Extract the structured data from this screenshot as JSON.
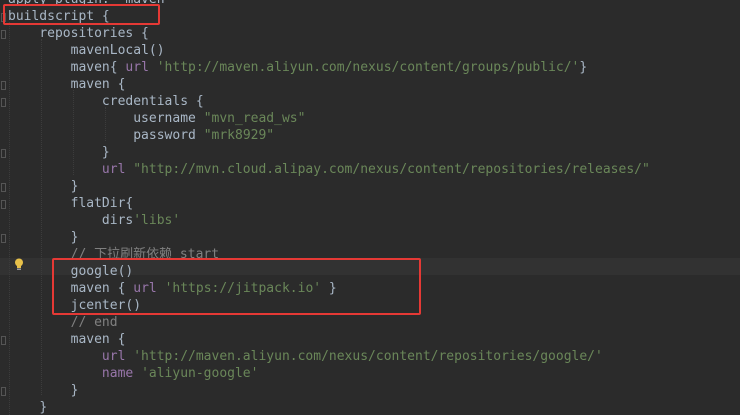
{
  "editor": {
    "lines": [
      {
        "indent": "",
        "parts": [
          {
            "t": "apply plugin: 'maven'",
            "c": "k"
          }
        ]
      },
      {
        "indent": "",
        "parts": [
          {
            "t": "buildscript {",
            "c": "k"
          }
        ]
      },
      {
        "indent": "    ",
        "parts": [
          {
            "t": "repositories {",
            "c": "k"
          }
        ]
      },
      {
        "indent": "        ",
        "parts": [
          {
            "t": "mavenLocal()",
            "c": "k"
          }
        ]
      },
      {
        "indent": "        ",
        "parts": [
          {
            "t": "maven{ ",
            "c": "k"
          },
          {
            "t": "url",
            "c": "p"
          },
          {
            "t": " ",
            "c": "k"
          },
          {
            "t": "'http://maven.aliyun.com/nexus/content/groups/public/'",
            "c": "s"
          },
          {
            "t": "}",
            "c": "k"
          }
        ]
      },
      {
        "indent": "        ",
        "parts": [
          {
            "t": "maven {",
            "c": "k"
          }
        ]
      },
      {
        "indent": "            ",
        "parts": [
          {
            "t": "credentials {",
            "c": "k"
          }
        ]
      },
      {
        "indent": "                ",
        "parts": [
          {
            "t": "username ",
            "c": "k"
          },
          {
            "t": "\"mvn_read_ws\"",
            "c": "s"
          }
        ]
      },
      {
        "indent": "                ",
        "parts": [
          {
            "t": "password ",
            "c": "k"
          },
          {
            "t": "\"mrk8929\"",
            "c": "s"
          }
        ]
      },
      {
        "indent": "            ",
        "parts": [
          {
            "t": "}",
            "c": "k"
          }
        ]
      },
      {
        "indent": "            ",
        "parts": [
          {
            "t": "url",
            "c": "p"
          },
          {
            "t": " ",
            "c": "k"
          },
          {
            "t": "\"http://mvn.cloud.alipay.com/nexus/content/repositories/releases/\"",
            "c": "s"
          }
        ]
      },
      {
        "indent": "        ",
        "parts": [
          {
            "t": "}",
            "c": "k"
          }
        ]
      },
      {
        "indent": "        ",
        "parts": [
          {
            "t": "flatDir{",
            "c": "k"
          }
        ]
      },
      {
        "indent": "            ",
        "parts": [
          {
            "t": "dirs",
            "c": "k"
          },
          {
            "t": "'libs'",
            "c": "s"
          }
        ]
      },
      {
        "indent": "        ",
        "parts": [
          {
            "t": "}",
            "c": "k"
          }
        ]
      },
      {
        "indent": "        ",
        "parts": [
          {
            "t": "// 下拉刷新依赖 start",
            "c": "c"
          }
        ]
      },
      {
        "indent": "        ",
        "parts": [
          {
            "t": "google()",
            "c": "k"
          }
        ]
      },
      {
        "indent": "        ",
        "parts": [
          {
            "t": "maven { ",
            "c": "k"
          },
          {
            "t": "url",
            "c": "p"
          },
          {
            "t": " ",
            "c": "k"
          },
          {
            "t": "'https://jitpack.io'",
            "c": "s"
          },
          {
            "t": " }",
            "c": "k"
          }
        ]
      },
      {
        "indent": "        ",
        "parts": [
          {
            "t": "jcenter()",
            "c": "k"
          }
        ]
      },
      {
        "indent": "        ",
        "parts": [
          {
            "t": "// end",
            "c": "c"
          }
        ]
      },
      {
        "indent": "        ",
        "parts": [
          {
            "t": "maven {",
            "c": "k"
          }
        ]
      },
      {
        "indent": "            ",
        "parts": [
          {
            "t": "url",
            "c": "p"
          },
          {
            "t": " ",
            "c": "k"
          },
          {
            "t": "'http://maven.aliyun.com/nexus/content/repositories/google/'",
            "c": "s"
          }
        ]
      },
      {
        "indent": "            ",
        "parts": [
          {
            "t": "name",
            "c": "p"
          },
          {
            "t": " ",
            "c": "k"
          },
          {
            "t": "'aliyun-google'",
            "c": "s"
          }
        ]
      },
      {
        "indent": "        ",
        "parts": [
          {
            "t": "}",
            "c": "k"
          }
        ]
      },
      {
        "indent": "    ",
        "parts": [
          {
            "t": "}",
            "c": "k"
          }
        ]
      }
    ]
  },
  "colors": {
    "background": "#2b2b2b",
    "plain": "#a9b7c6",
    "property": "#9876aa",
    "string": "#6a8759",
    "comment": "#808080",
    "highlight_box": "#e53935"
  },
  "icons": {
    "intention": "lightbulb-icon"
  }
}
